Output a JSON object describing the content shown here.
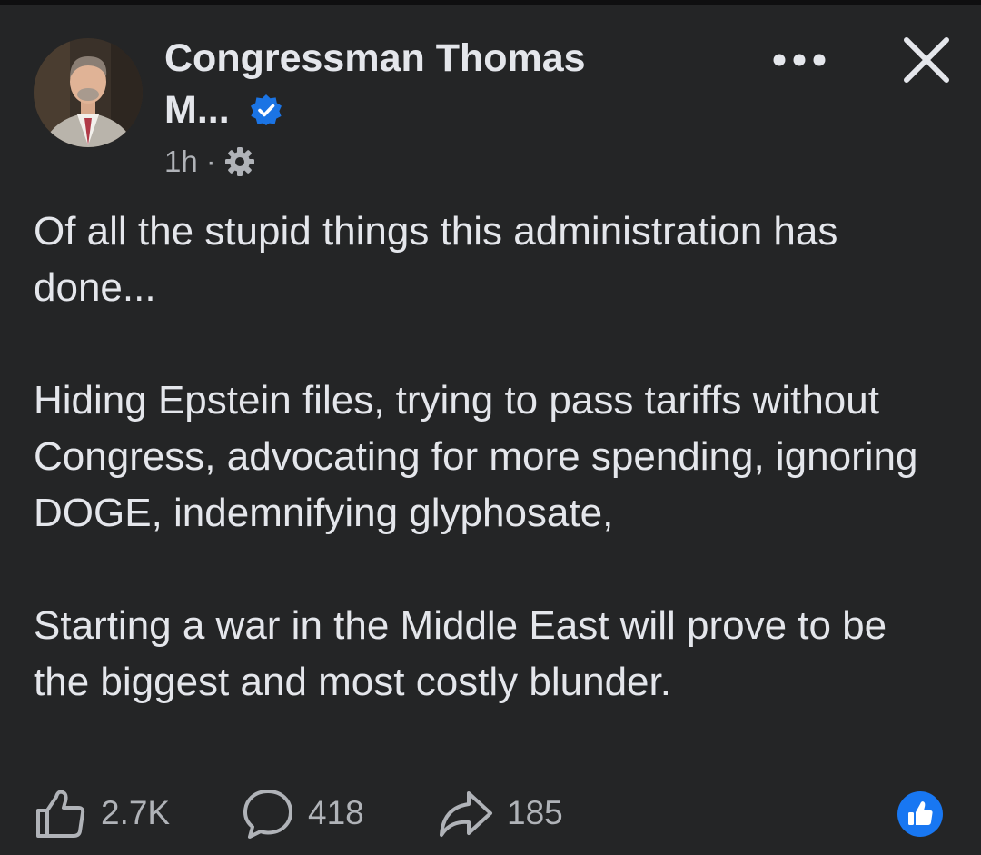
{
  "post": {
    "author_line1": "Congressman Thomas",
    "author_line2": "M...",
    "timestamp": "1h",
    "separator": "·",
    "audience_icon": "gear-icon",
    "paragraphs": [
      "Of all the stupid things this administration has done...",
      "Hiding Epstein files, trying to pass tariffs without Congress, advocating for more spending, ignoring DOGE, indemnifying glyphosate,",
      "Starting a war in the Middle East will prove to be the biggest and most costly blunder."
    ]
  },
  "header_actions": {
    "more_icon": "more-dots-icon",
    "close_icon": "close-icon"
  },
  "footer": {
    "likes": "2.7K",
    "comments": "418",
    "shares": "185",
    "like_icon": "thumbs-up-icon",
    "comment_icon": "comment-icon",
    "share_icon": "share-icon",
    "reaction_icon": "like-reaction-icon"
  },
  "colors": {
    "background": "#242526",
    "text_primary": "#e4e6eb",
    "text_secondary": "#b0b3b8",
    "verified_blue": "#1b74e4",
    "reaction_blue": "#1877f2"
  }
}
